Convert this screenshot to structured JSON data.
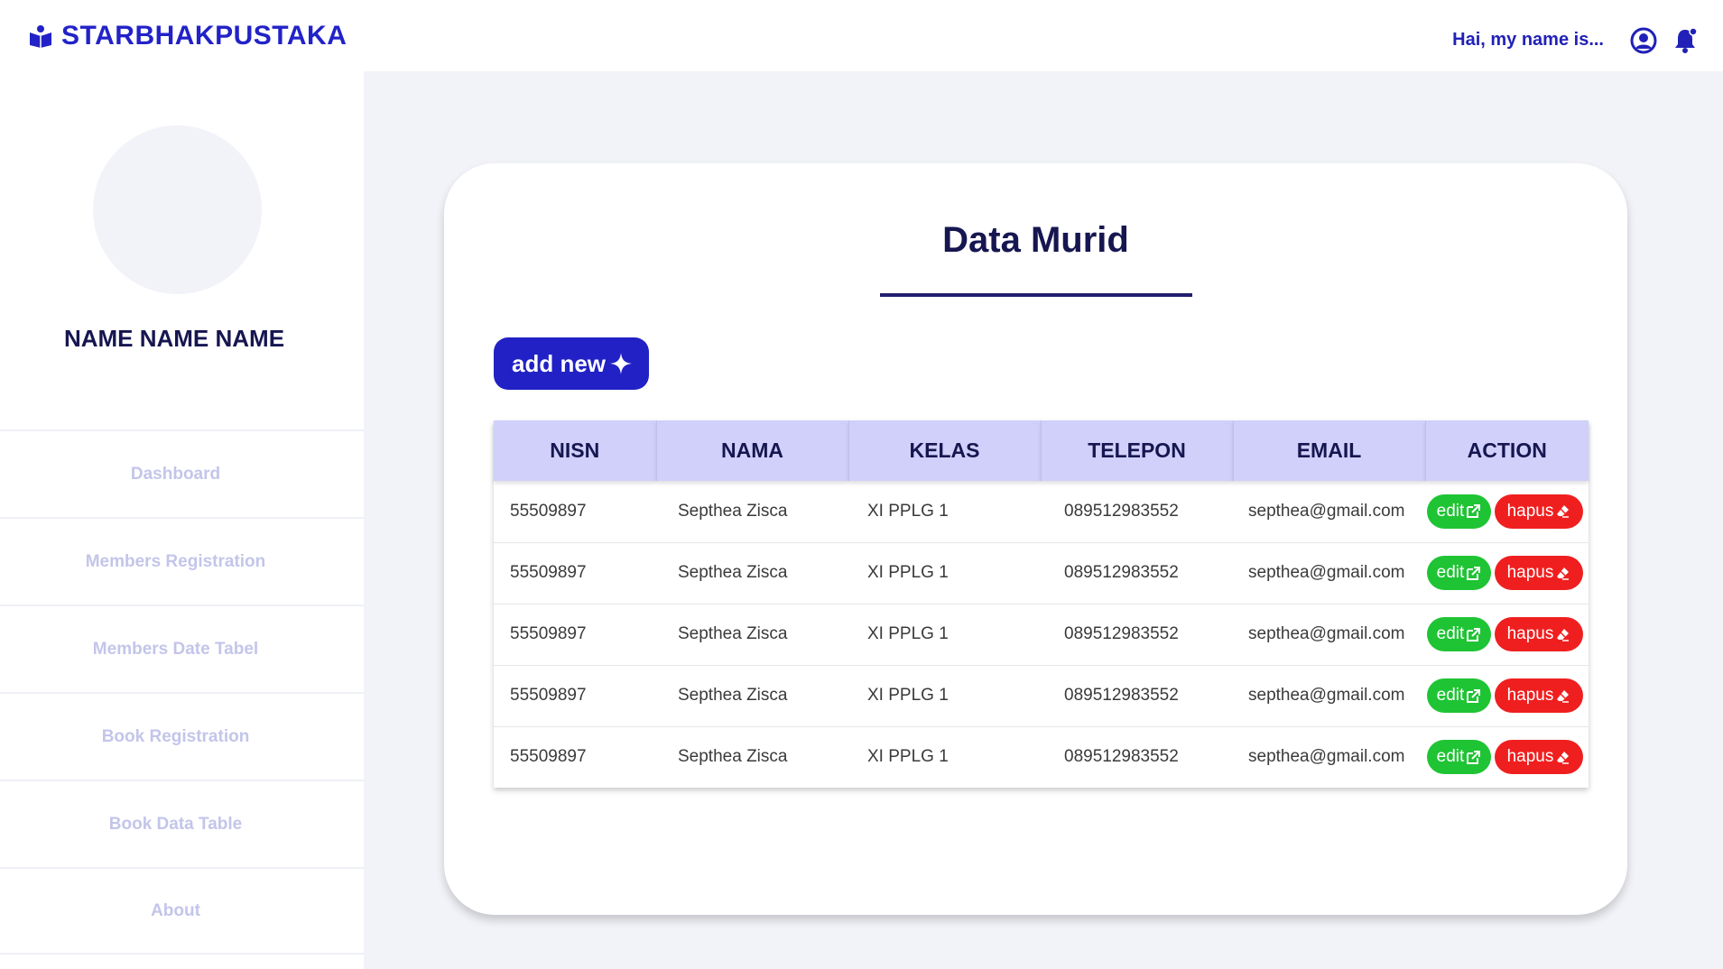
{
  "header": {
    "brand": "STARBHAKPUSTAKA",
    "greeting": "Hai, my name is..."
  },
  "sidebar": {
    "profile_name": "NAME NAME NAME",
    "items": [
      {
        "label": "Dashboard"
      },
      {
        "label": "Members Registration"
      },
      {
        "label": "Members Date Tabel"
      },
      {
        "label": "Book Registration"
      },
      {
        "label": "Book Data Table"
      },
      {
        "label": "About"
      }
    ]
  },
  "main": {
    "title": "Data Murid",
    "add_label": "add new",
    "columns": [
      "NISN",
      "NAMA",
      "KELAS",
      "TELEPON",
      "EMAIL",
      "ACTION"
    ],
    "rows": [
      {
        "nisn": "55509897",
        "nama": "Septhea Zisca",
        "kelas": "XI PPLG 1",
        "telepon": "089512983552",
        "email": "septhea@gmail.com"
      },
      {
        "nisn": "55509897",
        "nama": "Septhea Zisca",
        "kelas": "XI PPLG 1",
        "telepon": "089512983552",
        "email": "septhea@gmail.com"
      },
      {
        "nisn": "55509897",
        "nama": "Septhea Zisca",
        "kelas": "XI PPLG 1",
        "telepon": "089512983552",
        "email": "septhea@gmail.com"
      },
      {
        "nisn": "55509897",
        "nama": "Septhea Zisca",
        "kelas": "XI PPLG 1",
        "telepon": "089512983552",
        "email": "septhea@gmail.com"
      },
      {
        "nisn": "55509897",
        "nama": "Septhea Zisca",
        "kelas": "XI PPLG 1",
        "telepon": "089512983552",
        "email": "septhea@gmail.com"
      }
    ],
    "edit_label": "edit",
    "delete_label": "hapus"
  },
  "colors": {
    "brand": "#2222c8",
    "header_row": "#d0d0fb",
    "edit": "#1fc434",
    "delete": "#f01f1f"
  },
  "icons": {
    "brand": "book-reader-icon",
    "user": "user-circle-icon",
    "notification": "bell-icon",
    "add": "sparkle-icon",
    "edit": "external-edit-icon",
    "delete": "eraser-icon"
  }
}
